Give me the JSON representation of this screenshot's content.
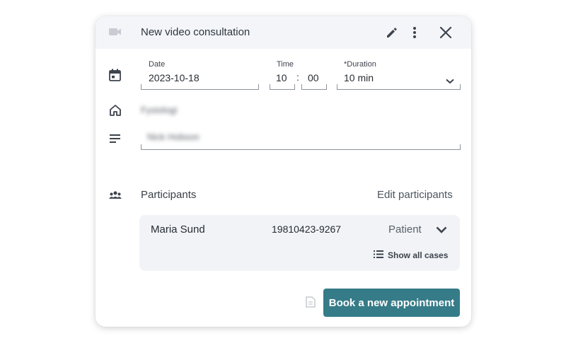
{
  "header": {
    "title": "New video consultation",
    "video_icon": "video-camera-icon",
    "edit_icon": "pencil-icon",
    "more_icon": "more-vertical-icon",
    "close_icon": "close-icon"
  },
  "form": {
    "date": {
      "label": "Date",
      "value": "2023-10-18"
    },
    "time": {
      "label": "Time",
      "hours": "10",
      "separator": ":",
      "minutes": "00"
    },
    "duration": {
      "label": "*Duration",
      "value": "10 min"
    },
    "location": {
      "value": "Fysiologi"
    },
    "notes": {
      "value": "Nick Hobson"
    }
  },
  "participants": {
    "title": "Participants",
    "edit_label": "Edit participants",
    "rows": [
      {
        "name": "Maria Sund",
        "id": "19810423-9267",
        "role": "Patient"
      }
    ],
    "show_all_label": "Show all cases"
  },
  "footer": {
    "book_label": "Book a new appointment"
  },
  "colors": {
    "primary": "#367b88",
    "header_bg": "#f3f5f9",
    "panel_bg": "#f1f3f7"
  }
}
